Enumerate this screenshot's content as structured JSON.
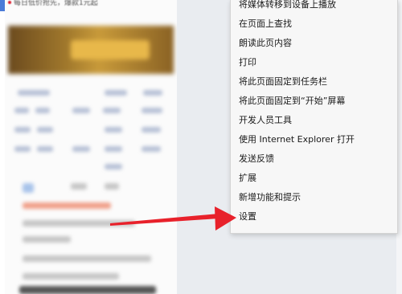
{
  "page": {
    "top_snippet": "每日低价抢先，爆款1元起"
  },
  "menu": {
    "items": [
      {
        "label": "将媒体转移到设备上播放"
      },
      {
        "label": "在页面上查找"
      },
      {
        "label": "朗读此页内容"
      },
      {
        "label": "打印"
      },
      {
        "label": "将此页面固定到任务栏"
      },
      {
        "label": "将此页面固定到“开始”屏幕"
      },
      {
        "label": "开发人员工具"
      },
      {
        "label": "使用 Internet Explorer 打开"
      },
      {
        "label": "发送反馈"
      },
      {
        "label": "扩展"
      },
      {
        "label": "新增功能和提示"
      },
      {
        "label": "设置"
      }
    ]
  },
  "colors": {
    "arrow": "#e8212b",
    "menu_bg": "#f7f7f7"
  }
}
